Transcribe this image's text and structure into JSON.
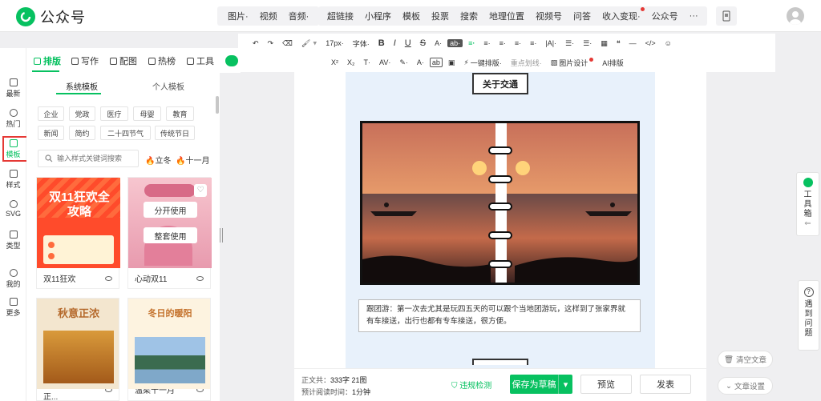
{
  "app": {
    "title": "公众号"
  },
  "topbar": {
    "insert_group1": [
      "图片·",
      "视频",
      "音频·"
    ],
    "insert_group2": [
      "超链接",
      "小程序",
      "模板",
      "投票",
      "搜索",
      "地理位置",
      "视频号",
      "问答",
      "收入变现·",
      "公众号",
      "···"
    ]
  },
  "rail": {
    "items": [
      {
        "label": "最新",
        "icon": "latest-icon"
      },
      {
        "label": "热门",
        "icon": "hot-icon"
      },
      {
        "label": "模板",
        "icon": "template-icon",
        "selected": true
      },
      {
        "label": "样式",
        "icon": "style-icon"
      },
      {
        "label": "SVG",
        "icon": "svg-icon"
      },
      {
        "label": "类型",
        "icon": "type-icon"
      },
      {
        "label": "我的",
        "icon": "mine-icon"
      },
      {
        "label": "更多",
        "icon": "more-icon"
      }
    ]
  },
  "nav": {
    "tabs": [
      "排版",
      "写作",
      "配图",
      "热榜",
      "工具"
    ]
  },
  "panel": {
    "subtabs": [
      "系统模板",
      "个人模板"
    ],
    "tags_row1": [
      "企业",
      "党政",
      "医疗",
      "母婴",
      "教育"
    ],
    "tags_row2": [
      "新闻",
      "简约",
      "二十四节气",
      "传统节日"
    ],
    "search_placeholder": "输入样式关键词搜索",
    "hot1": "立冬",
    "hot2": "十一月",
    "cards": [
      {
        "name": "双11狂欢",
        "thumb_title": "双11狂欢全攻略"
      },
      {
        "name": "心动双11",
        "overlay_btn1": "分开使用",
        "overlay_btn2": "整套使用"
      },
      {
        "name": "十一月，秋意正...",
        "thumb_title": "秋意正浓"
      },
      {
        "name": "温柔十一月",
        "thumb_title": "冬日的暖阳"
      }
    ]
  },
  "toolbar": {
    "row1": [
      "17px·",
      "字体·",
      "B",
      "I",
      "U",
      "S",
      "A·",
      "ab·",
      "≡·",
      "≡·",
      "≡·",
      "≡·",
      "≡·",
      "|A|·",
      "☰·",
      "☰·",
      "▦",
      "❝",
      "—",
      "</>",
      "☺"
    ],
    "row2": [
      "X²",
      "X₂",
      "T·",
      "AV·",
      "✎·",
      "A·",
      "ab",
      "▣",
      "一键排版·",
      "重点划线·",
      "图片设计",
      "AI排版"
    ]
  },
  "article": {
    "section_title": "关于交通",
    "caption": "跟团游：第一次去尤其是玩四五天的可以跟个当地团游玩，这样到了张家界就有车接送，出行也都有专车接送，很方便。"
  },
  "bottom": {
    "word_label": "正文共：",
    "word_value": "333字 21图",
    "read_label": "预计阅读时间：",
    "read_value": "1分钟",
    "violation": "违规检测",
    "save": "保存为草稿",
    "preview": "预览",
    "publish": "发表"
  },
  "right": {
    "toolbox": "工具箱",
    "help": "遇到问题",
    "clear": "清空文章",
    "settings": "文章设置"
  },
  "colors": {
    "brand": "#07c160",
    "highlight": "#e53935",
    "article_bg": "#e8f1fb"
  }
}
